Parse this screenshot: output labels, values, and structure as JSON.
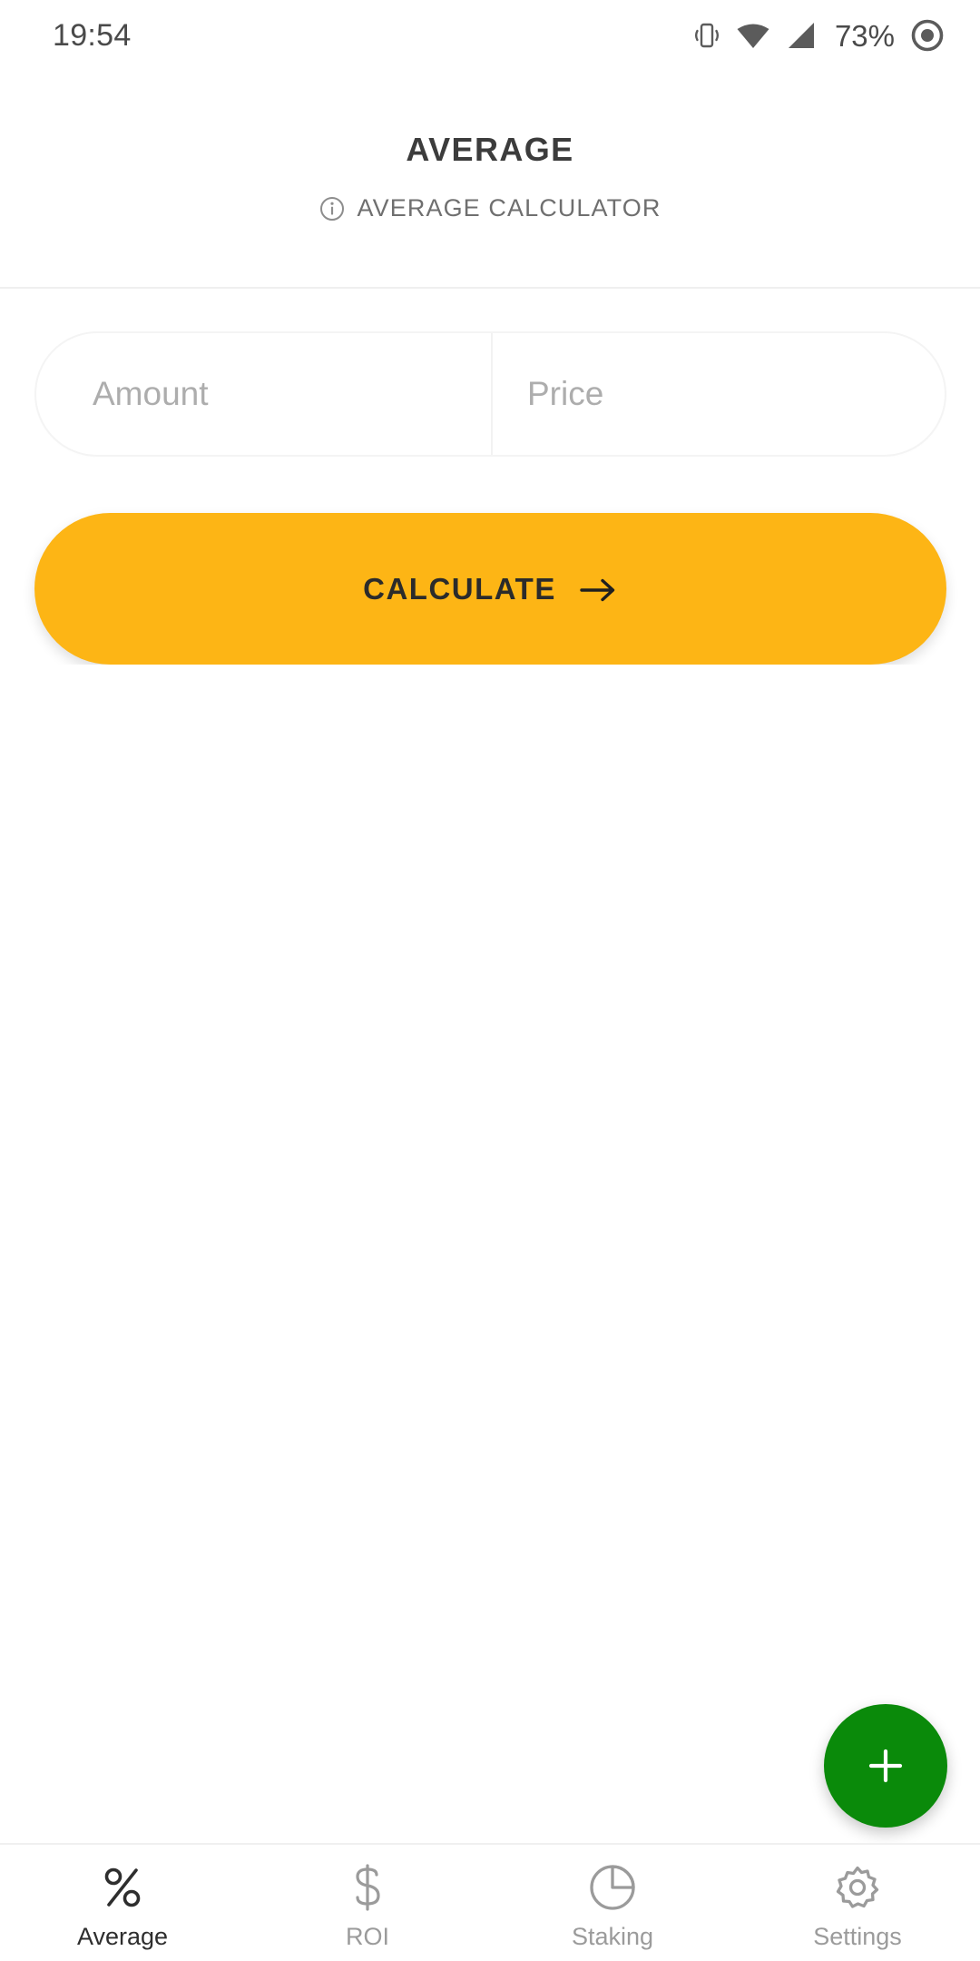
{
  "status_bar": {
    "time": "19:54",
    "battery_percent": "73%",
    "icons": [
      "vibrate-icon",
      "wifi-icon",
      "cellular-signal-icon",
      "battery-icon"
    ]
  },
  "header": {
    "title": "AVERAGE",
    "subtitle": "AVERAGE CALCULATOR",
    "info_icon": "info-icon"
  },
  "form": {
    "amount": {
      "value": "",
      "placeholder": "Amount"
    },
    "price": {
      "value": "",
      "placeholder": "Price"
    }
  },
  "actions": {
    "calculate_label": "CALCULATE",
    "calculate_arrow_icon": "arrow-right-icon",
    "calculate_color": "#fdb515",
    "fab_icon": "plus-icon",
    "fab_color": "#0a8a0a"
  },
  "bottom_nav": {
    "items": [
      {
        "label": "Average",
        "icon": "percent-icon",
        "active": true
      },
      {
        "label": "ROI",
        "icon": "dollar-icon",
        "active": false
      },
      {
        "label": "Staking",
        "icon": "pie-chart-icon",
        "active": false
      },
      {
        "label": "Settings",
        "icon": "gear-icon",
        "active": false
      }
    ]
  },
  "colors": {
    "accent_orange": "#fdb515",
    "accent_green": "#0a8a0a",
    "text_primary": "#3c3c3c",
    "text_muted": "#9b9b9b",
    "background": "#ffffff"
  }
}
